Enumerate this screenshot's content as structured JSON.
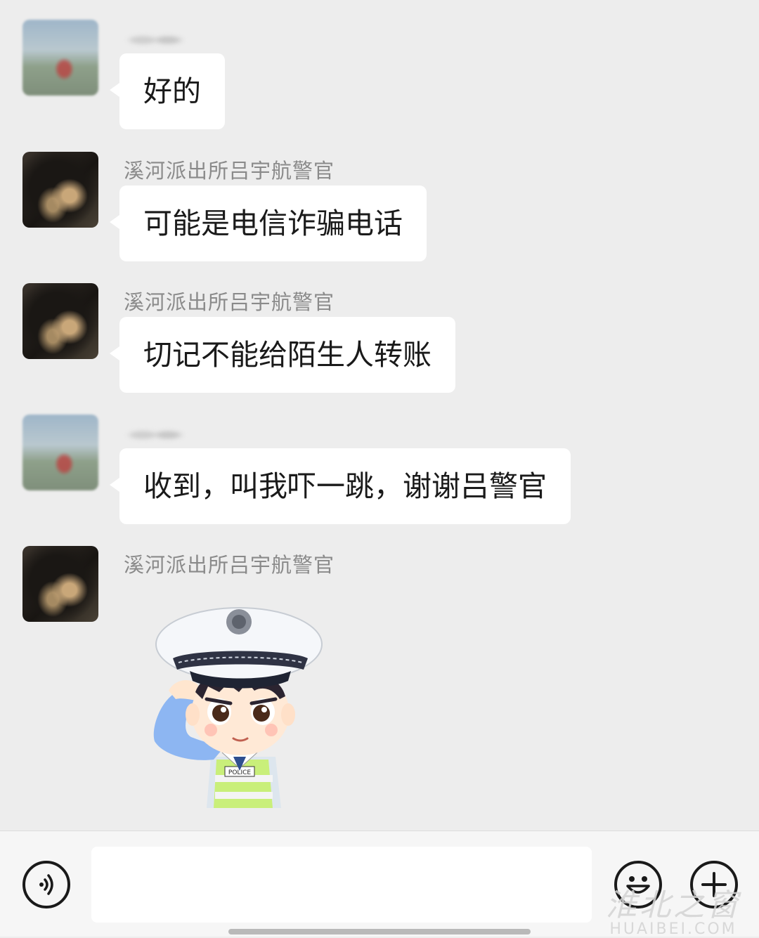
{
  "messages": [
    {
      "sender": "",
      "text": "好的"
    },
    {
      "sender": "溪河派出所吕宇航警官",
      "text": "可能是电信诈骗电话"
    },
    {
      "sender": "溪河派出所吕宇航警官",
      "text": "切记不能给陌生人转账"
    },
    {
      "sender": "",
      "text": "收到，叫我吓一跳，谢谢吕警官"
    },
    {
      "sender": "溪河派出所吕宇航警官",
      "sticker": "police-officer-salute-sticker",
      "sticker_badge": "POLICE"
    }
  ],
  "input_bar": {
    "voice_icon": "voice-icon",
    "text_value": "",
    "emoji_icon": "emoji-icon",
    "plus_icon": "plus-icon"
  },
  "watermark": {
    "line1": "淮北之窗",
    "line2": "HUAIBEI.COM"
  },
  "colors": {
    "background": "#ededed",
    "bubble": "#ffffff",
    "sender_text": "#8a8a8a"
  }
}
